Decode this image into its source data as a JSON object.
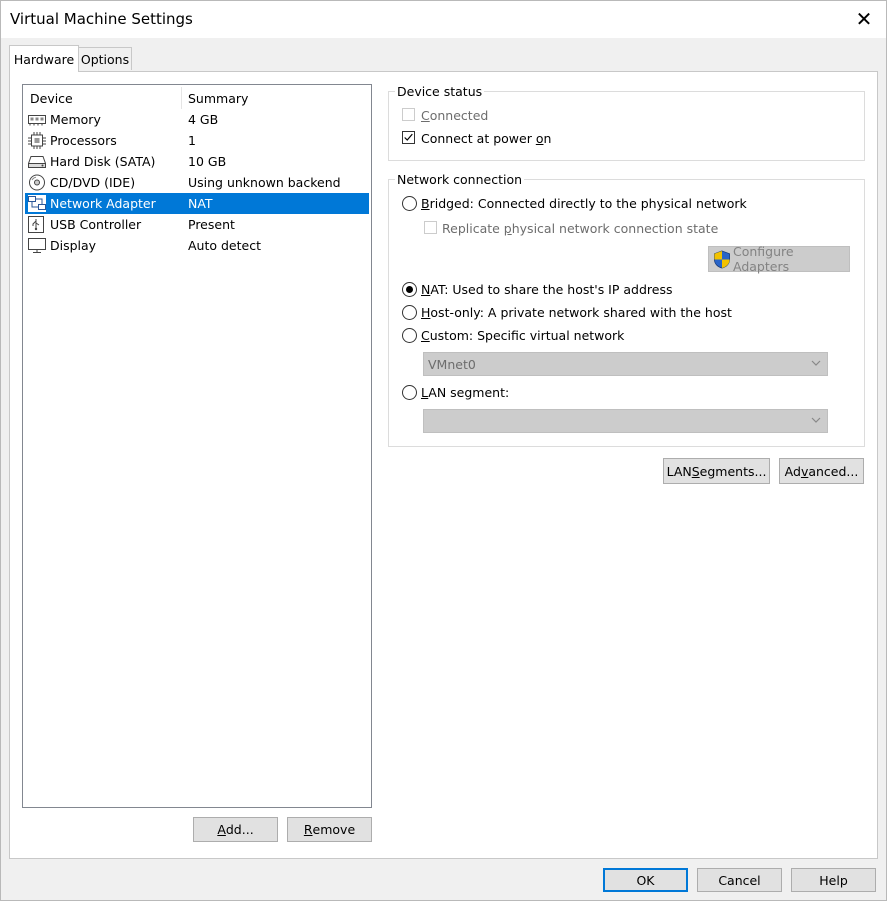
{
  "window": {
    "title": "Virtual Machine Settings",
    "close_glyph": "✕"
  },
  "tabs": [
    {
      "label": "Hardware"
    },
    {
      "label": "Options"
    }
  ],
  "device_list": {
    "headers": {
      "device": "Device",
      "summary": "Summary"
    },
    "rows": [
      {
        "name": "Memory",
        "summary": "4 GB",
        "icon": "memory-icon"
      },
      {
        "name": "Processors",
        "summary": "1",
        "icon": "processor-icon"
      },
      {
        "name": "Hard Disk (SATA)",
        "summary": "10 GB",
        "icon": "hard-disk-icon"
      },
      {
        "name": "CD/DVD (IDE)",
        "summary": "Using unknown backend",
        "icon": "cd-dvd-icon"
      },
      {
        "name": "Network Adapter",
        "summary": "NAT",
        "icon": "network-adapter-icon",
        "selected": true
      },
      {
        "name": "USB Controller",
        "summary": "Present",
        "icon": "usb-icon"
      },
      {
        "name": "Display",
        "summary": "Auto detect",
        "icon": "display-icon"
      }
    ],
    "add_button": {
      "before": "",
      "mnemonic": "A",
      "after": "dd..."
    },
    "remove_button": {
      "before": "",
      "mnemonic": "R",
      "after": "emove"
    }
  },
  "device_status": {
    "label": "Device status",
    "connected": {
      "before": "",
      "mnemonic": "C",
      "after": "onnected",
      "checked": false,
      "enabled": false
    },
    "connect_at_power_on": {
      "before": "Connect at power ",
      "mnemonic": "o",
      "after": "n",
      "checked": true,
      "enabled": true
    }
  },
  "network_connection": {
    "label": "Network connection",
    "bridged": {
      "mnemonic": "B",
      "after": "ridged: Connected directly to the physical network",
      "selected": false
    },
    "replicate": {
      "before": "Replicate ",
      "mnemonic": "p",
      "after": "hysical network connection state",
      "checked": false,
      "enabled": false
    },
    "configure_adapters": {
      "label": "Configure Adapters",
      "icon": "uac-shield-icon",
      "enabled": false
    },
    "nat": {
      "mnemonic": "N",
      "after": "AT: Used to share the host's IP address",
      "selected": true
    },
    "host_only": {
      "mnemonic": "H",
      "after": "ost-only: A private network shared with the host",
      "selected": false
    },
    "custom": {
      "mnemonic": "C",
      "after": "ustom: Specific virtual network",
      "selected": false
    },
    "custom_select": {
      "value": "VMnet0",
      "enabled": false
    },
    "lan_segment": {
      "mnemonic": "L",
      "after": "AN segment:",
      "selected": false
    },
    "lan_select": {
      "value": "",
      "enabled": false
    }
  },
  "lan_segments_button": {
    "before": "LAN ",
    "mnemonic": "S",
    "after": "egments..."
  },
  "advanced_button": {
    "before": "Ad",
    "mnemonic": "v",
    "after": "anced..."
  },
  "footer": {
    "ok": "OK",
    "cancel": "Cancel",
    "help": "Help"
  },
  "colors": {
    "selection": "#0078d7",
    "face": "#f0f0f0",
    "button": "#e1e1e1"
  }
}
